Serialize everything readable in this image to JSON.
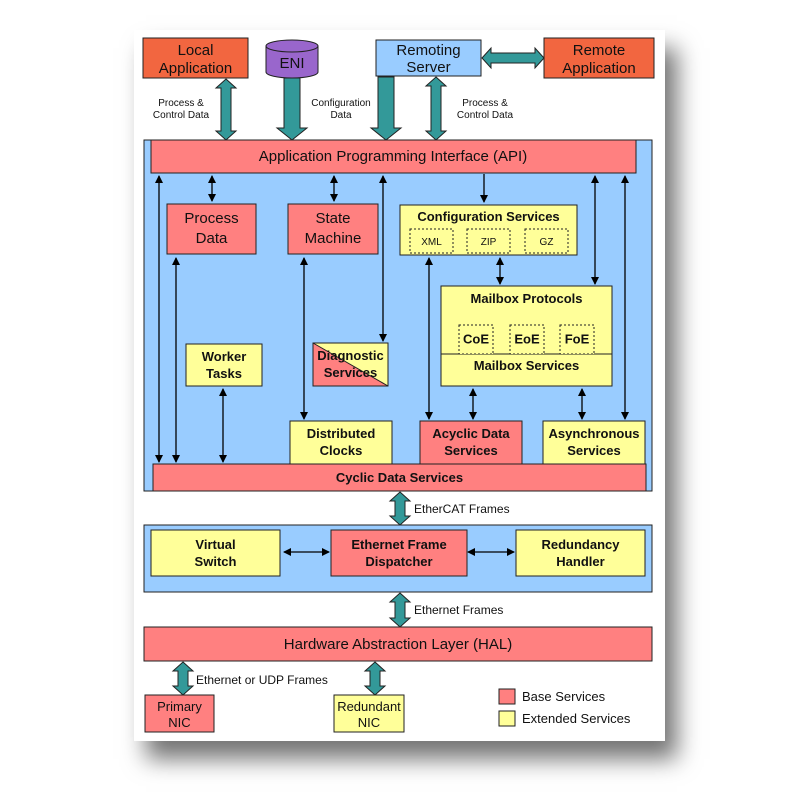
{
  "colors": {
    "base": "#ff8080",
    "extended": "#ffff99",
    "application": "#f26640",
    "eni": "#9966cc",
    "remoting": "#99ccff",
    "panel": "#99ccff",
    "teal_arrow": "#339999"
  },
  "top": {
    "local_app": [
      "Local",
      "Application"
    ],
    "eni": "ENI",
    "remoting_server": [
      "Remoting",
      "Server"
    ],
    "remote_app": [
      "Remote",
      "Application"
    ],
    "label_process_left": [
      "Process &",
      "Control Data"
    ],
    "label_config": [
      "Configuration",
      "Data"
    ],
    "label_process_right": [
      "Process &",
      "Control Data"
    ]
  },
  "stack": {
    "api": "Application Programming Interface (API)",
    "process_data": [
      "Process",
      "Data"
    ],
    "state_machine": [
      "State",
      "Machine"
    ],
    "config_services": "Configuration Services",
    "config_formats": [
      "XML",
      "ZIP",
      "GZ"
    ],
    "mailbox_protocols": "Mailbox Protocols",
    "protocols": [
      "CoE",
      "EoE",
      "FoE"
    ],
    "mailbox_services": "Mailbox Services",
    "worker_tasks": [
      "Worker",
      "Tasks"
    ],
    "diagnostic_services": [
      "Diagnostic",
      "Services"
    ],
    "distributed_clocks": [
      "Distributed",
      "Clocks"
    ],
    "acyclic_data": [
      "Acyclic Data",
      "Services"
    ],
    "asynchronous": [
      "Asynchronous",
      "Services"
    ],
    "cyclic_data": "Cyclic Data Services",
    "ethercat_frames": "EtherCAT Frames",
    "virtual_switch": [
      "Virtual",
      "Switch"
    ],
    "frame_dispatcher": [
      "Ethernet Frame",
      "Dispatcher"
    ],
    "redundancy_handler": [
      "Redundancy",
      "Handler"
    ],
    "ethernet_frames": "Ethernet Frames",
    "hal": "Hardware Abstraction Layer (HAL)",
    "eth_udp_frames": "Ethernet or UDP Frames",
    "primary_nic": [
      "Primary",
      "NIC"
    ],
    "redundant_nic": [
      "Redundant",
      "NIC"
    ]
  },
  "legend": {
    "base": "Base Services",
    "extended": "Extended Services"
  }
}
